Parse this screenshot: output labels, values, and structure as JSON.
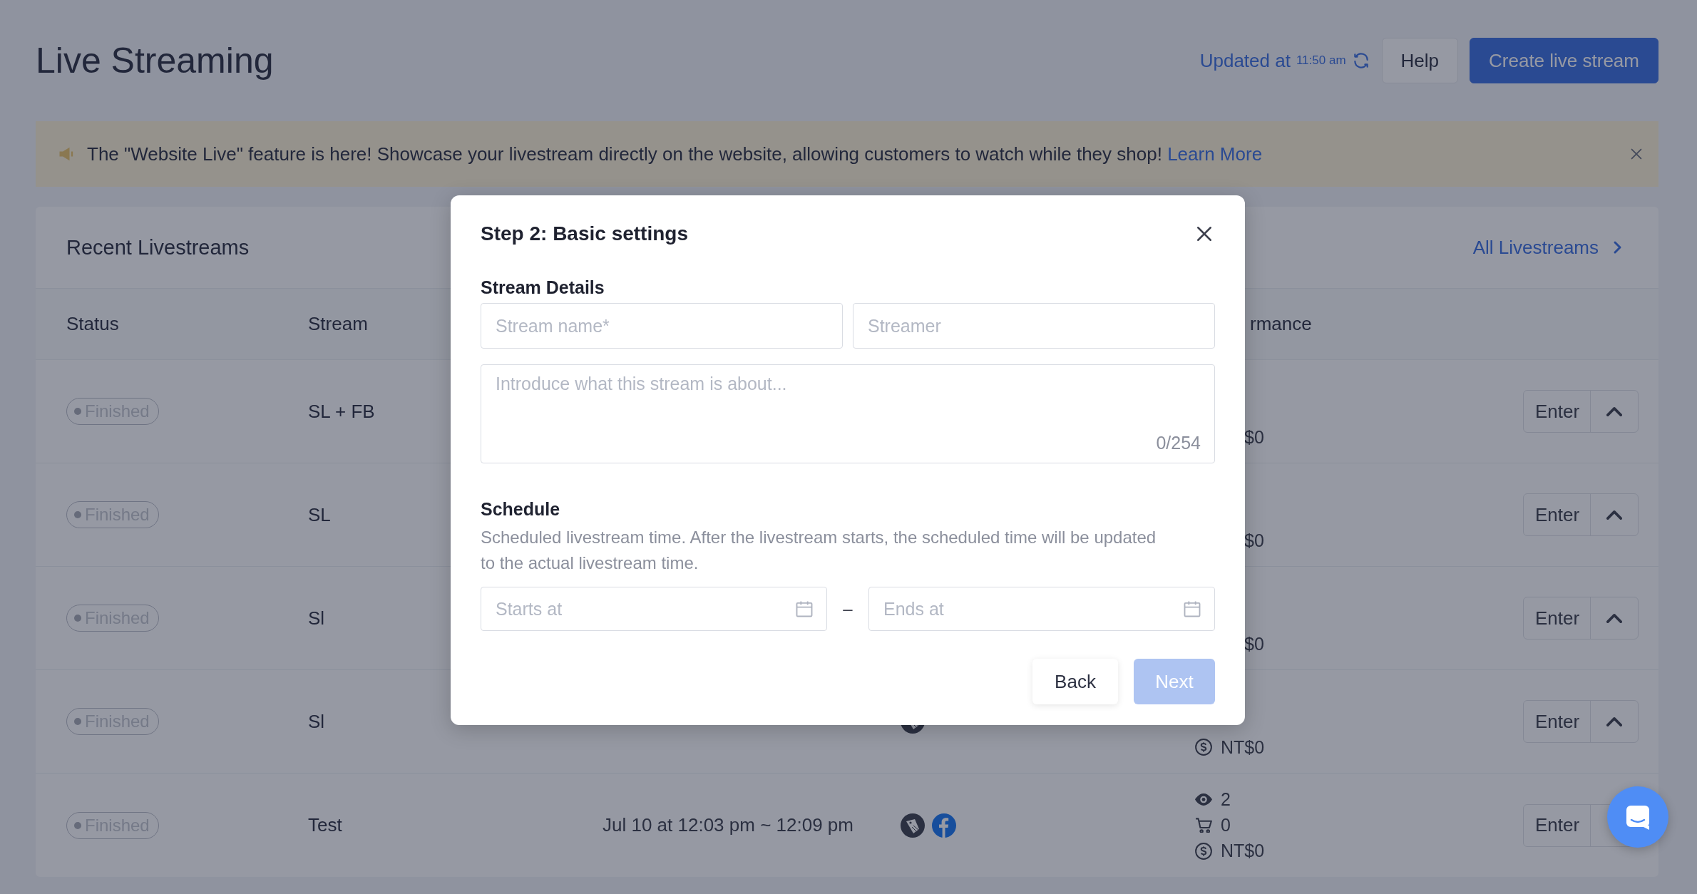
{
  "header": {
    "title": "Live Streaming",
    "updated_label": "Updated at",
    "updated_time": "11:50 am",
    "help_button": "Help",
    "create_button": "Create live stream"
  },
  "banner": {
    "text": "The \"Website Live\" feature is here! Showcase your livestream directly on the website, allowing customers to watch while they shop!",
    "link": "Learn More"
  },
  "card": {
    "title": "Recent Livestreams",
    "link": "All Livestreams",
    "columns": [
      {
        "kind": "status",
        "label": "Status"
      },
      {
        "kind": "stream",
        "label": "Stream"
      },
      {
        "kind": "performance",
        "label": "rmance"
      }
    ],
    "rows": [
      {
        "status": "Finished",
        "stream": "SL + FB",
        "performance": [
          {
            "kind": "money",
            "value": "$0",
            "icon": false
          }
        ],
        "action": "Enter",
        "toggle": true
      },
      {
        "status": "Finished",
        "stream": "SL",
        "performance": [
          {
            "kind": "money",
            "value": "$0",
            "icon": false
          }
        ],
        "action": "Enter",
        "toggle": true
      },
      {
        "status": "Finished",
        "stream": "Sl",
        "performance": [
          {
            "kind": "money",
            "value": "$0",
            "icon": false
          }
        ],
        "action": "Enter",
        "toggle": true
      },
      {
        "status": "Finished",
        "stream": "Sl",
        "platforms": [
          {
            "kind": "shop"
          }
        ],
        "performance": [
          {
            "kind": "money",
            "value": "NT$0",
            "icon": true
          }
        ],
        "action": "Enter",
        "toggle": true
      },
      {
        "status": "Finished",
        "stream": "Test",
        "date": "Jul 10 at 12:03 pm ~ 12:09 pm",
        "platforms": [
          {
            "kind": "shop"
          },
          {
            "kind": "social"
          }
        ],
        "performance": [
          {
            "kind": "views",
            "value": "2",
            "icon": true
          },
          {
            "kind": "orders",
            "value": "0",
            "icon": true
          },
          {
            "kind": "money",
            "value": "NT$0",
            "icon": true
          }
        ],
        "action": "Enter",
        "toggle": false
      }
    ]
  },
  "modal": {
    "title": "Step 2: Basic settings",
    "details_label": "Stream Details",
    "name_placeholder": "Stream name*",
    "streamer_placeholder": "Streamer",
    "description_placeholder": "Introduce what this stream is about...",
    "counter": "0/254",
    "schedule_label": "Schedule",
    "schedule_note": "Scheduled livestream time. After the livestream starts, the scheduled time will be updated to the actual livestream time.",
    "start_placeholder": "Starts at",
    "separator": "–",
    "end_placeholder": "Ends at",
    "back_button": "Back",
    "next_button": "Next",
    "next_disabled": true
  }
}
